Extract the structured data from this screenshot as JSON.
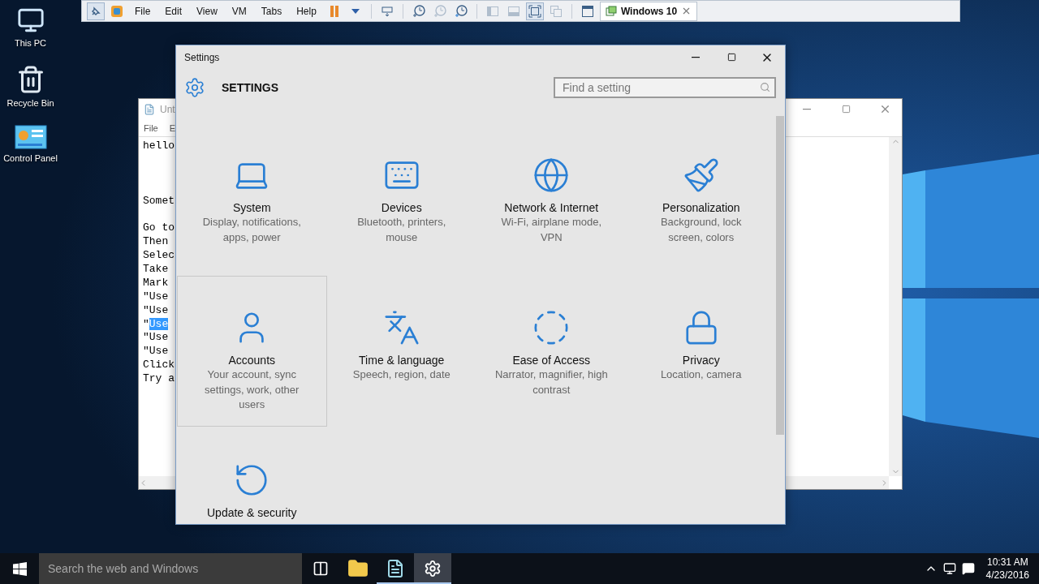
{
  "vm_toolbar": {
    "buttons": [
      {
        "kind": "pin",
        "pressed": true,
        "disabled": false
      },
      {
        "kind": "vm-logo",
        "pressed": false,
        "disabled": false
      }
    ],
    "menus": [
      "File",
      "Edit",
      "View",
      "VM",
      "Tabs",
      "Help"
    ],
    "tools": [
      {
        "kind": "pause",
        "pressed": false,
        "disabled": false
      },
      {
        "kind": "caret",
        "pressed": false,
        "disabled": false
      },
      {
        "kind": "sep"
      },
      {
        "kind": "send-keys",
        "pressed": false,
        "disabled": false
      },
      {
        "kind": "sep"
      },
      {
        "kind": "snapshot",
        "pressed": false,
        "disabled": false
      },
      {
        "kind": "revert",
        "pressed": false,
        "disabled": true
      },
      {
        "kind": "manager",
        "pressed": false,
        "disabled": false
      },
      {
        "kind": "sep"
      },
      {
        "kind": "sidebar",
        "pressed": false,
        "disabled": true
      },
      {
        "kind": "thumbnails",
        "pressed": false,
        "disabled": true
      },
      {
        "kind": "fullscreen",
        "pressed": true,
        "disabled": false
      },
      {
        "kind": "unity",
        "pressed": false,
        "disabled": true
      },
      {
        "kind": "sep"
      },
      {
        "kind": "console",
        "pressed": false,
        "disabled": false
      }
    ],
    "tab": {
      "title": "Windows 10"
    }
  },
  "desktop_icons": [
    {
      "label": "This PC",
      "kind": "pc"
    },
    {
      "label": "Recycle Bin",
      "kind": "bin"
    },
    {
      "label": "Control Panel",
      "kind": "panel"
    }
  ],
  "notepad": {
    "title": "Unt",
    "menus": [
      "File",
      "E"
    ],
    "lines": [
      {
        "kind": "text",
        "text": "hello"
      },
      {
        "kind": "blank"
      },
      {
        "kind": "blank"
      },
      {
        "kind": "blank"
      },
      {
        "kind": "text",
        "text": "Somet"
      },
      {
        "kind": "blank"
      },
      {
        "kind": "text",
        "text": "Go to"
      },
      {
        "kind": "text",
        "text": "Then"
      },
      {
        "kind": "text",
        "text": "Selec"
      },
      {
        "kind": "text",
        "text": "Take"
      },
      {
        "kind": "text",
        "text": "Mark"
      },
      {
        "kind": "text",
        "text": "\"Use"
      },
      {
        "kind": "text",
        "text": "\"Use"
      },
      {
        "kind": "text",
        "text": "\"",
        "selection": "Use"
      },
      {
        "kind": "text",
        "text": "\"Use"
      },
      {
        "kind": "text",
        "text": "\"Use"
      },
      {
        "kind": "text",
        "text": "Click"
      },
      {
        "kind": "text",
        "text": "Try a"
      }
    ]
  },
  "settings": {
    "title": "Settings",
    "heading": "SETTINGS",
    "search": {
      "placeholder": "Find a setting"
    },
    "tiles": [
      {
        "kind": "system",
        "title": "System",
        "description": "Display, notifications, apps, power",
        "hovered": false
      },
      {
        "kind": "devices",
        "title": "Devices",
        "description": "Bluetooth, printers, mouse",
        "hovered": false
      },
      {
        "kind": "network",
        "title": "Network & Internet",
        "description": "Wi-Fi, airplane mode, VPN",
        "hovered": false
      },
      {
        "kind": "personalization",
        "title": "Personalization",
        "description": "Background, lock screen, colors",
        "hovered": false
      },
      {
        "kind": "accounts",
        "title": "Accounts",
        "description": "Your account, sync settings, work, other users",
        "hovered": true
      },
      {
        "kind": "time",
        "title": "Time & language",
        "description": "Speech, region, date",
        "hovered": false
      },
      {
        "kind": "ease",
        "title": "Ease of Access",
        "description": "Narrator, magnifier, high contrast",
        "hovered": false
      },
      {
        "kind": "privacy",
        "title": "Privacy",
        "description": "Location, camera",
        "hovered": false
      },
      {
        "kind": "update",
        "title": "Update & security",
        "hovered": false
      }
    ]
  },
  "taskbar": {
    "search": {
      "placeholder": "Search the web and Windows"
    },
    "apps": [
      {
        "kind": "task-view",
        "running": false,
        "active": false
      },
      {
        "kind": "explorer",
        "running": false,
        "active": false
      },
      {
        "kind": "notepad",
        "running": true,
        "active": false
      },
      {
        "kind": "settings",
        "running": true,
        "active": true
      }
    ],
    "clock": {
      "time": "10:31 AM",
      "date": "4/23/2016"
    }
  }
}
